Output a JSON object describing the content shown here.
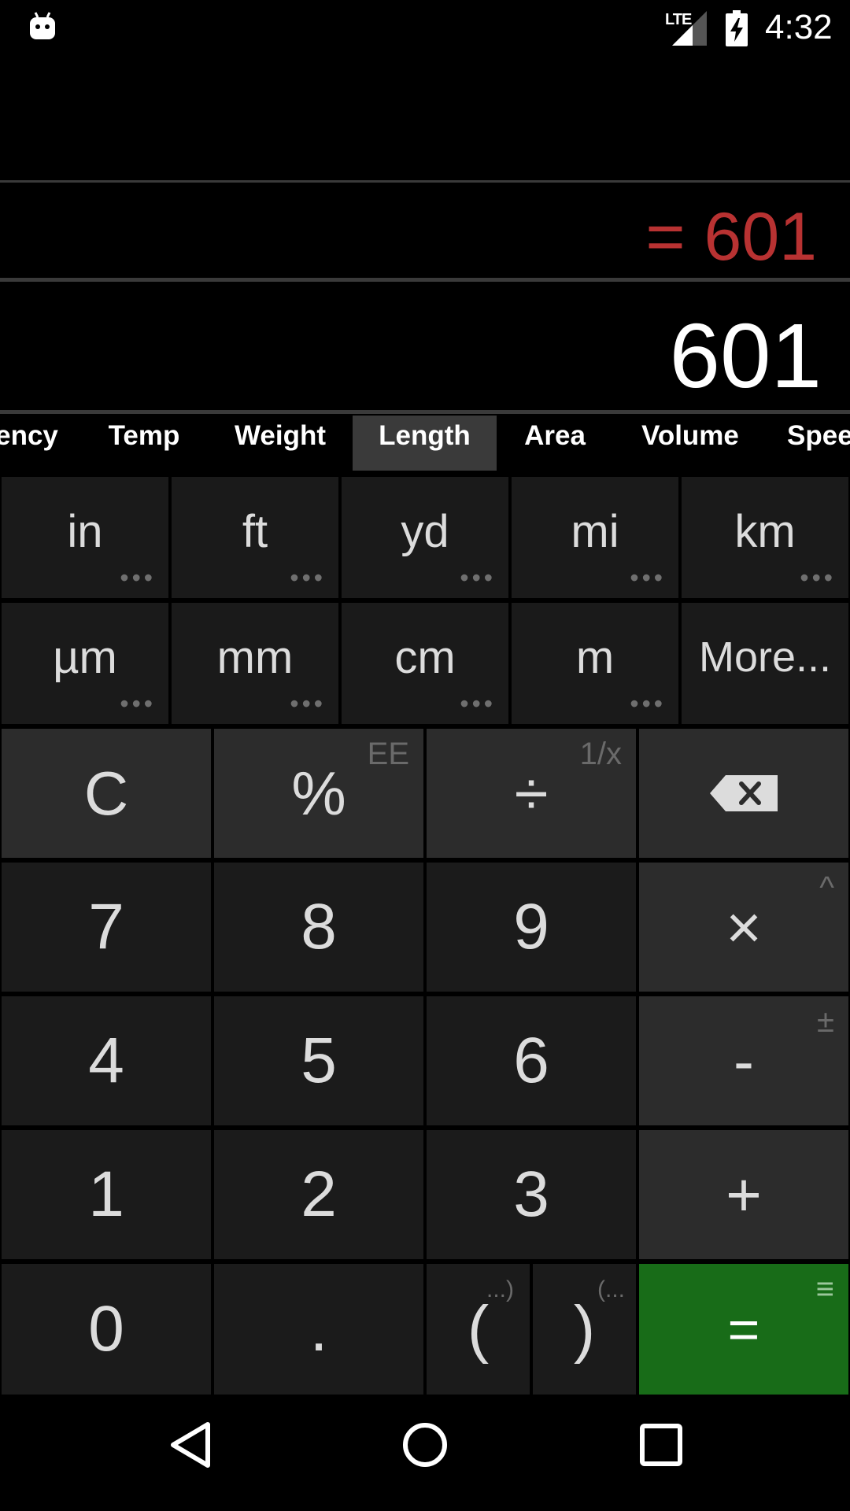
{
  "status_bar": {
    "time": "4:32",
    "network": "LTE",
    "icons": [
      "android-bot-icon",
      "signal-icon",
      "battery-charging-icon"
    ]
  },
  "display": {
    "result": "= 601",
    "input": "601"
  },
  "tabs": [
    "ency",
    "Temp",
    "Weight",
    "Length",
    "Area",
    "Volume",
    "Spee"
  ],
  "active_tab": "Length",
  "units": {
    "row1": [
      "in",
      "ft",
      "yd",
      "mi",
      "km"
    ],
    "row2": [
      "µm",
      "mm",
      "cm",
      "m",
      "More..."
    ],
    "more_indicator": "•••"
  },
  "keypad": {
    "clear": "C",
    "percent": "%",
    "percent_secondary": "EE",
    "divide": "÷",
    "divide_secondary": "1/x",
    "backspace_icon": "backspace-icon",
    "seven": "7",
    "eight": "8",
    "nine": "9",
    "multiply": "×",
    "multiply_secondary": "^",
    "four": "4",
    "five": "5",
    "six": "6",
    "minus": "-",
    "minus_secondary": "±",
    "one": "1",
    "two": "2",
    "three": "3",
    "plus": "+",
    "zero": "0",
    "dot": ".",
    "paren_open": "(",
    "paren_open_secondary": "...)",
    "paren_close": ")",
    "paren_close_secondary": "(...",
    "equals": "=",
    "equals_secondary": "≡"
  },
  "colors": {
    "result": "#b83232",
    "equals_key": "#186c18",
    "active_tab": "#3a3a3a"
  },
  "nav_bar": [
    "back-icon",
    "home-icon",
    "recents-icon"
  ]
}
